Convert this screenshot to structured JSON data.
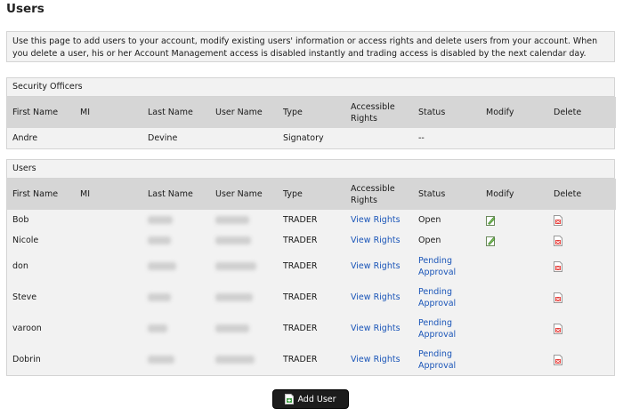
{
  "page": {
    "title": "Users",
    "info": "Use this page to add users to your account, modify existing users' information or access rights and delete users from your account. When you delete a user, his or her Account Management access is disabled instantly and trading access is disabled by the next calendar day."
  },
  "columns": {
    "first_name": "First Name",
    "mi": "MI",
    "last_name": "Last Name",
    "user_name": "User Name",
    "type": "Type",
    "accessible_rights_1": "Accessible",
    "accessible_rights_2": "Rights",
    "status": "Status",
    "modify": "Modify",
    "delete": "Delete"
  },
  "security_officers": {
    "caption": "Security Officers",
    "rows": [
      {
        "first_name": "Andre",
        "mi": "",
        "last_name": "Devine",
        "user_name": "",
        "type": "Signatory",
        "status": "--"
      }
    ]
  },
  "users": {
    "caption": "Users",
    "rows": [
      {
        "first_name": "Bob",
        "type": "TRADER",
        "rights": "View Rights",
        "status_1": "Open",
        "status_2": ""
      },
      {
        "first_name": "Nicole",
        "type": "TRADER",
        "rights": "View Rights",
        "status_1": "Open",
        "status_2": ""
      },
      {
        "first_name": "don",
        "type": "TRADER",
        "rights": "View Rights",
        "status_1": "Pending",
        "status_2": "Approval"
      },
      {
        "first_name": "Steve",
        "type": "TRADER",
        "rights": "View Rights",
        "status_1": "Pending",
        "status_2": "Approval"
      },
      {
        "first_name": "varoon",
        "type": "TRADER",
        "rights": "View Rights",
        "status_1": "Pending",
        "status_2": "Approval"
      },
      {
        "first_name": "Dobrin",
        "type": "TRADER",
        "rights": "View Rights",
        "status_1": "Pending",
        "status_2": "Approval"
      }
    ]
  },
  "add_user": {
    "label": "Add User"
  },
  "icons": {
    "modify": "edit-icon",
    "delete": "delete-icon",
    "add_user": "add-user-icon"
  }
}
